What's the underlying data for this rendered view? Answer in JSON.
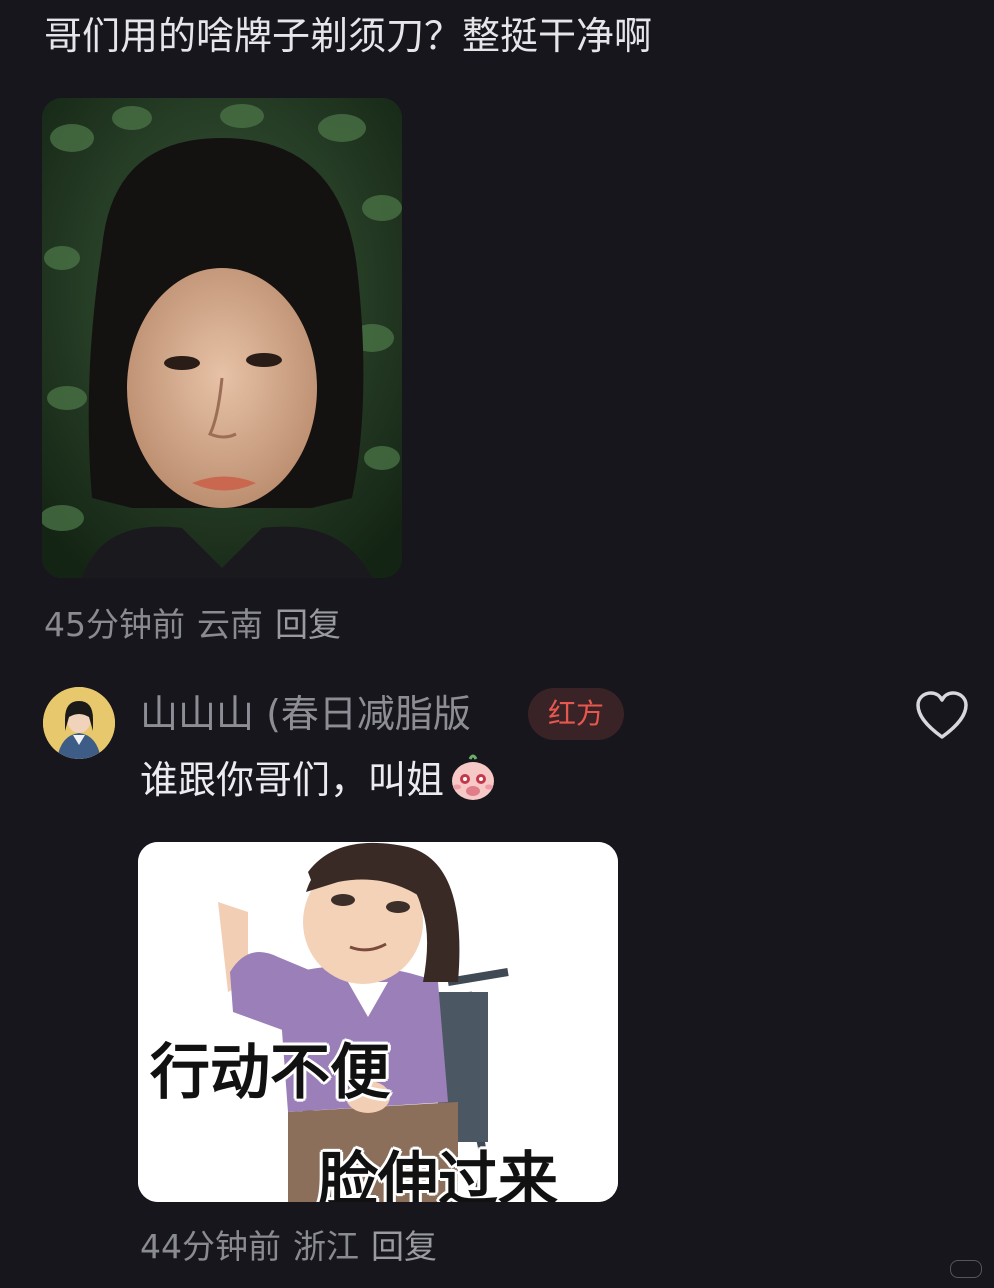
{
  "comment": {
    "text": "哥们用的啥牌子剃须刀？整挺干净啊",
    "time": "45分钟前",
    "location": "云南",
    "reply_label": "回复"
  },
  "reply": {
    "username": "山山山 (春日减脂版",
    "badge": "红方",
    "text": "谁跟你哥们，叫姐",
    "emoji_icon": "blushing-emoji-icon",
    "meme_caption_1": "行动不便",
    "meme_caption_2": "脸伸过来",
    "time": "44分钟前",
    "location": "浙江",
    "reply_label": "回复",
    "like_icon": "heart-outline-icon"
  },
  "colors": {
    "background": "#16161c",
    "meta_text": "#8a8a92",
    "badge_text": "#e8574e",
    "badge_bg": "#3a2326"
  }
}
